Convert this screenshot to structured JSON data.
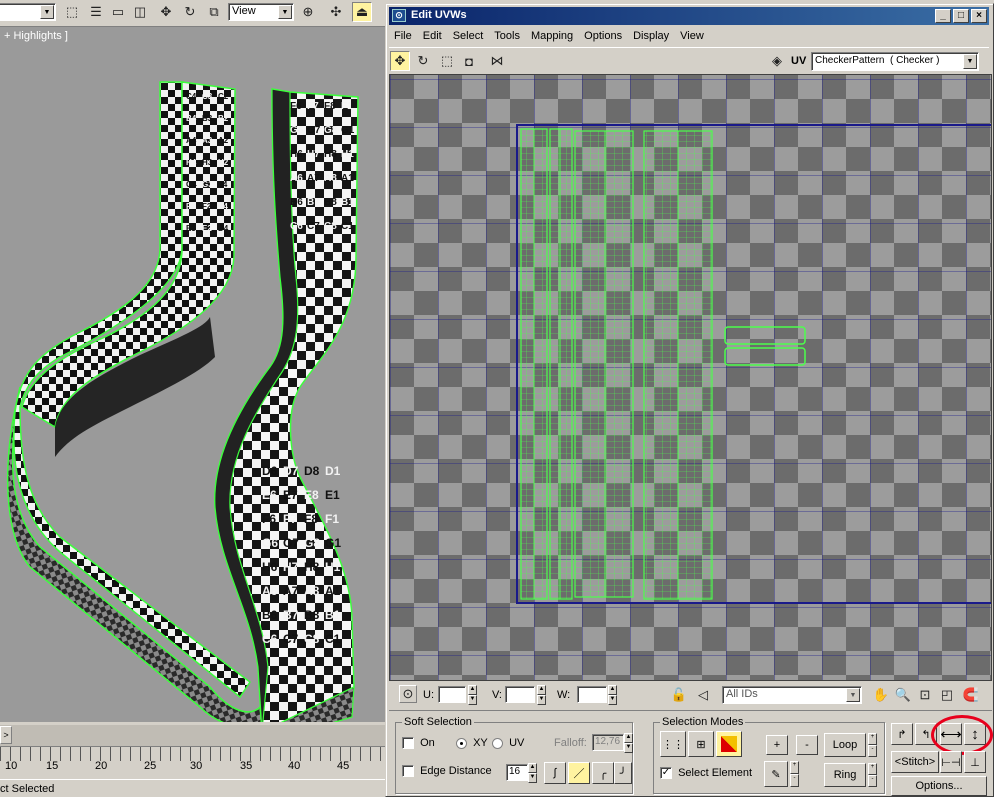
{
  "main_toolbar": {
    "view_dropdown": "View"
  },
  "viewport": {
    "label": "+ Highlights ]",
    "tiles_back_leg": [
      "C4",
      "C3",
      "C2",
      "B4",
      "B3",
      "B2",
      "A4",
      "A3",
      "A2",
      "H4",
      "H3",
      "H2",
      "G4",
      "G3",
      "F4",
      "F3",
      "F2",
      "E4",
      "E3",
      "E2",
      "D4",
      "D3",
      "C4",
      "C3",
      "B4",
      "B3",
      "A3",
      "A4"
    ],
    "tiles_front_leg": [
      "F6",
      "F7",
      "F8",
      "F1",
      "G6",
      "G7",
      "G8",
      "G1",
      "H6",
      "H7",
      "H8",
      "H1",
      "A6",
      "A7",
      "A8",
      "A1",
      "B6",
      "B7",
      "B8",
      "B1",
      "C6",
      "C7",
      "C8",
      "C1",
      "D6",
      "D7",
      "D8",
      "D1",
      "E6",
      "E7",
      "E8",
      "E1",
      "F6",
      "F7",
      "F8",
      "F1",
      "G6",
      "G7",
      "G8",
      "G1",
      "H6",
      "H7",
      "H8",
      "H1",
      "A6",
      "A7",
      "A8",
      "A1",
      "B6",
      "B7",
      "B8",
      "B1",
      "C6",
      "C7",
      "C8",
      "C1",
      "D6",
      "D7",
      "D8",
      "D1",
      "E6",
      "E7",
      "E8",
      "E1",
      "F6",
      "F7",
      "F8",
      "F1",
      "G6",
      "G7",
      "G8",
      "G1",
      "H6",
      "H7",
      "H8",
      "H1",
      "A6",
      "A7",
      "A8",
      "A1"
    ]
  },
  "timeline": {
    "ticks": [
      "10",
      "15",
      "20",
      "25",
      "30",
      "35",
      "40",
      "45"
    ],
    "marker": ">"
  },
  "status": {
    "text": "ct Selected"
  },
  "uvw_window": {
    "title": "Edit UVWs",
    "menus": [
      "File",
      "Edit",
      "Select",
      "Tools",
      "Mapping",
      "Options",
      "Display",
      "View"
    ],
    "uv_label": "UV",
    "texture_dropdown": "CheckerPattern  ( Checker )",
    "coords": {
      "u_label": "U:",
      "v_label": "V:",
      "w_label": "W:",
      "u": "",
      "v": "",
      "w": ""
    },
    "ids_dropdown": "All IDs"
  },
  "soft_selection": {
    "title": "Soft Selection",
    "on_label": "On",
    "xy_label": "XY",
    "uv_label": "UV",
    "falloff_label": "Falloff:",
    "falloff_value": "12,76",
    "edge_distance_label": "Edge Distance",
    "edge_distance_value": "16"
  },
  "selection_modes": {
    "title": "Selection Modes",
    "plus": "+",
    "minus": "-",
    "loop_label": "Loop",
    "ring_label": "Ring",
    "select_element_label": "Select Element",
    "select_element_checked": "✓"
  },
  "right_tools": {
    "stitch_left": "<",
    "stitch_label": "Stitch",
    "stitch_right": ">",
    "options_label": "Options..."
  },
  "colors": {
    "uv_wire": "#4cff4c",
    "grid_line": "#1a1a8a",
    "annotation": "#e8001c"
  }
}
